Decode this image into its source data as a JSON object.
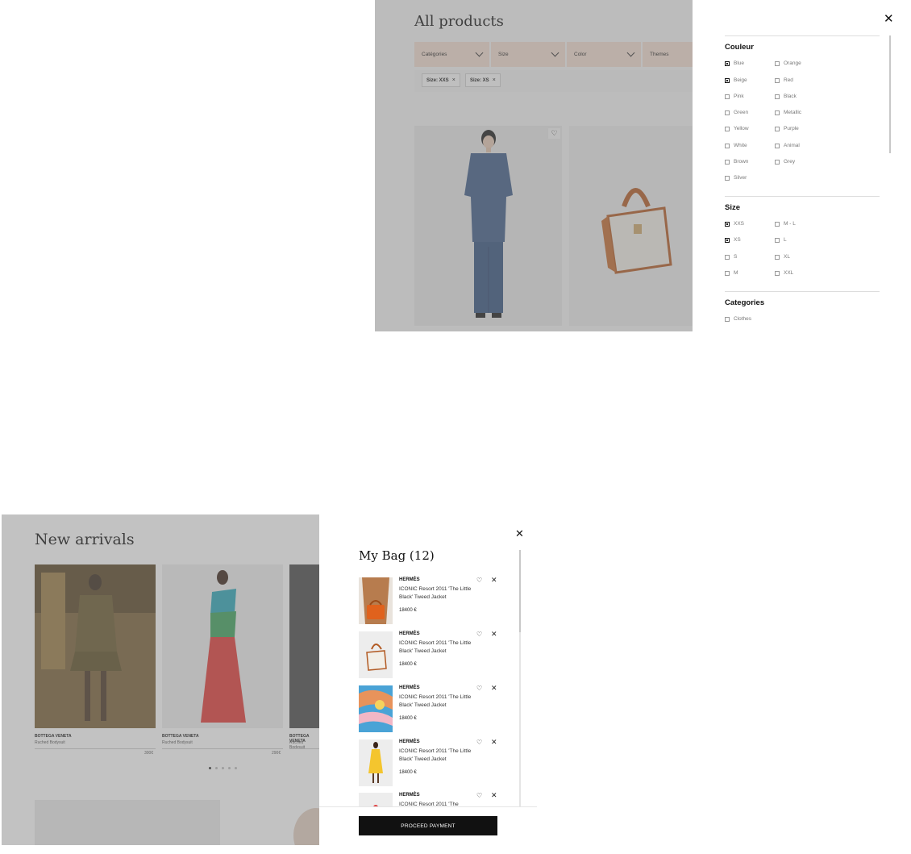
{
  "catalog": {
    "title": "All products",
    "filters": [
      "Catégories",
      "Size",
      "Color",
      "Themes"
    ],
    "chips": [
      {
        "label": "Size: XXS"
      },
      {
        "label": "Size: XS"
      }
    ],
    "wishlist_icon": "heart-icon"
  },
  "filter_panel": {
    "close_icon": "close-icon",
    "couleur": {
      "title": "Couleur",
      "left": [
        {
          "label": "Blue",
          "checked": true
        },
        {
          "label": "Beige",
          "checked": true
        },
        {
          "label": "Pink",
          "checked": false
        },
        {
          "label": "Green",
          "checked": false
        },
        {
          "label": "Yellow",
          "checked": false
        },
        {
          "label": "White",
          "checked": false
        },
        {
          "label": "Brown",
          "checked": false
        },
        {
          "label": "Silver",
          "checked": false
        }
      ],
      "right": [
        {
          "label": "Orange",
          "checked": false
        },
        {
          "label": "Red",
          "checked": false
        },
        {
          "label": "Black",
          "checked": false
        },
        {
          "label": "Metallic",
          "checked": false
        },
        {
          "label": "Purple",
          "checked": false
        },
        {
          "label": "Animal",
          "checked": false
        },
        {
          "label": "Grey",
          "checked": false
        }
      ]
    },
    "size": {
      "title": "Size",
      "left": [
        {
          "label": "XXS",
          "checked": true
        },
        {
          "label": "XS",
          "checked": true
        },
        {
          "label": "S",
          "checked": false
        },
        {
          "label": "M",
          "checked": false
        }
      ],
      "right": [
        {
          "label": "M - L",
          "checked": false
        },
        {
          "label": "L",
          "checked": false
        },
        {
          "label": "XL",
          "checked": false
        },
        {
          "label": "XXL",
          "checked": false
        }
      ]
    },
    "categories": {
      "title": "Categories",
      "items": [
        {
          "label": "Clothes",
          "checked": false
        }
      ]
    }
  },
  "store": {
    "title": "New arrivals",
    "items": [
      {
        "brand": "BOTTEGA VENETA",
        "name": "Ruched Bodysuit",
        "price": "300€"
      },
      {
        "brand": "BOTTEGA VENETA",
        "name": "Ruched Bodysuit",
        "price": "290€"
      },
      {
        "brand": "BOTTEGA VENETA",
        "name": "Ruched Bodysuit",
        "price": ""
      }
    ],
    "carousel_dots": 5,
    "active_dot": 0
  },
  "bag": {
    "title": "My Bag (12)",
    "close_icon": "close-icon",
    "items": [
      {
        "brand": "HERMÈS",
        "name": "ICONIC Resort 2011 'The Little Black' Tweed Jacket",
        "price": "18400 €"
      },
      {
        "brand": "HERMÈS",
        "name": "ICONIC Resort 2011 'The Little Black' Tweed Jacket",
        "price": "18400 €"
      },
      {
        "brand": "HERMÈS",
        "name": "ICONIC Resort 2011 'The Little Black' Tweed Jacket",
        "price": "18400 €"
      },
      {
        "brand": "HERMÈS",
        "name": "ICONIC Resort 2011 'The Little Black' Tweed Jacket",
        "price": "18400 €"
      },
      {
        "brand": "HERMÈS",
        "name": "ICONIC Resort 2011 'The",
        "price": ""
      }
    ],
    "pay_label": "PROCEED PAYMENT",
    "colors": {
      "accent": "#111111",
      "filter_bar": "#f3ddd0"
    }
  }
}
